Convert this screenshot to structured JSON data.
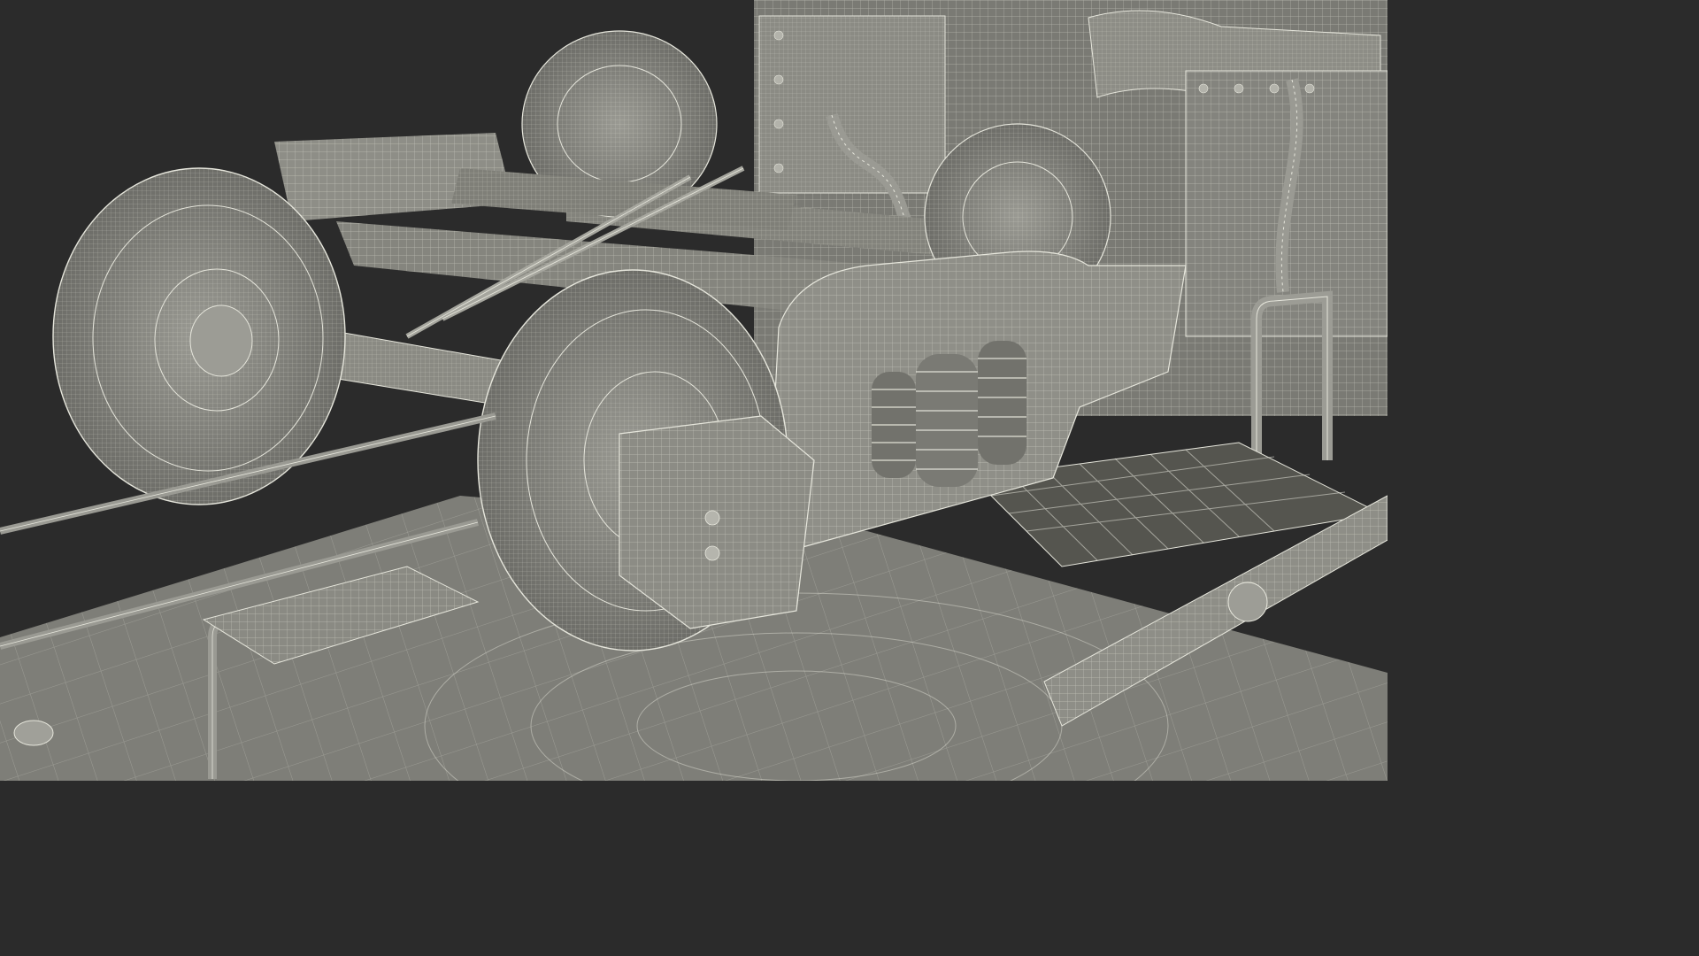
{
  "scene": {
    "subject": "railway-bogie-wireframe-render",
    "colors": {
      "background": "#2b2b2b",
      "surface": "#8b8b84",
      "surface_dark": "#5f5f5a",
      "surface_light": "#a4a49c",
      "wire": "#e6e6dc",
      "shadow": "#3a3a37"
    }
  }
}
